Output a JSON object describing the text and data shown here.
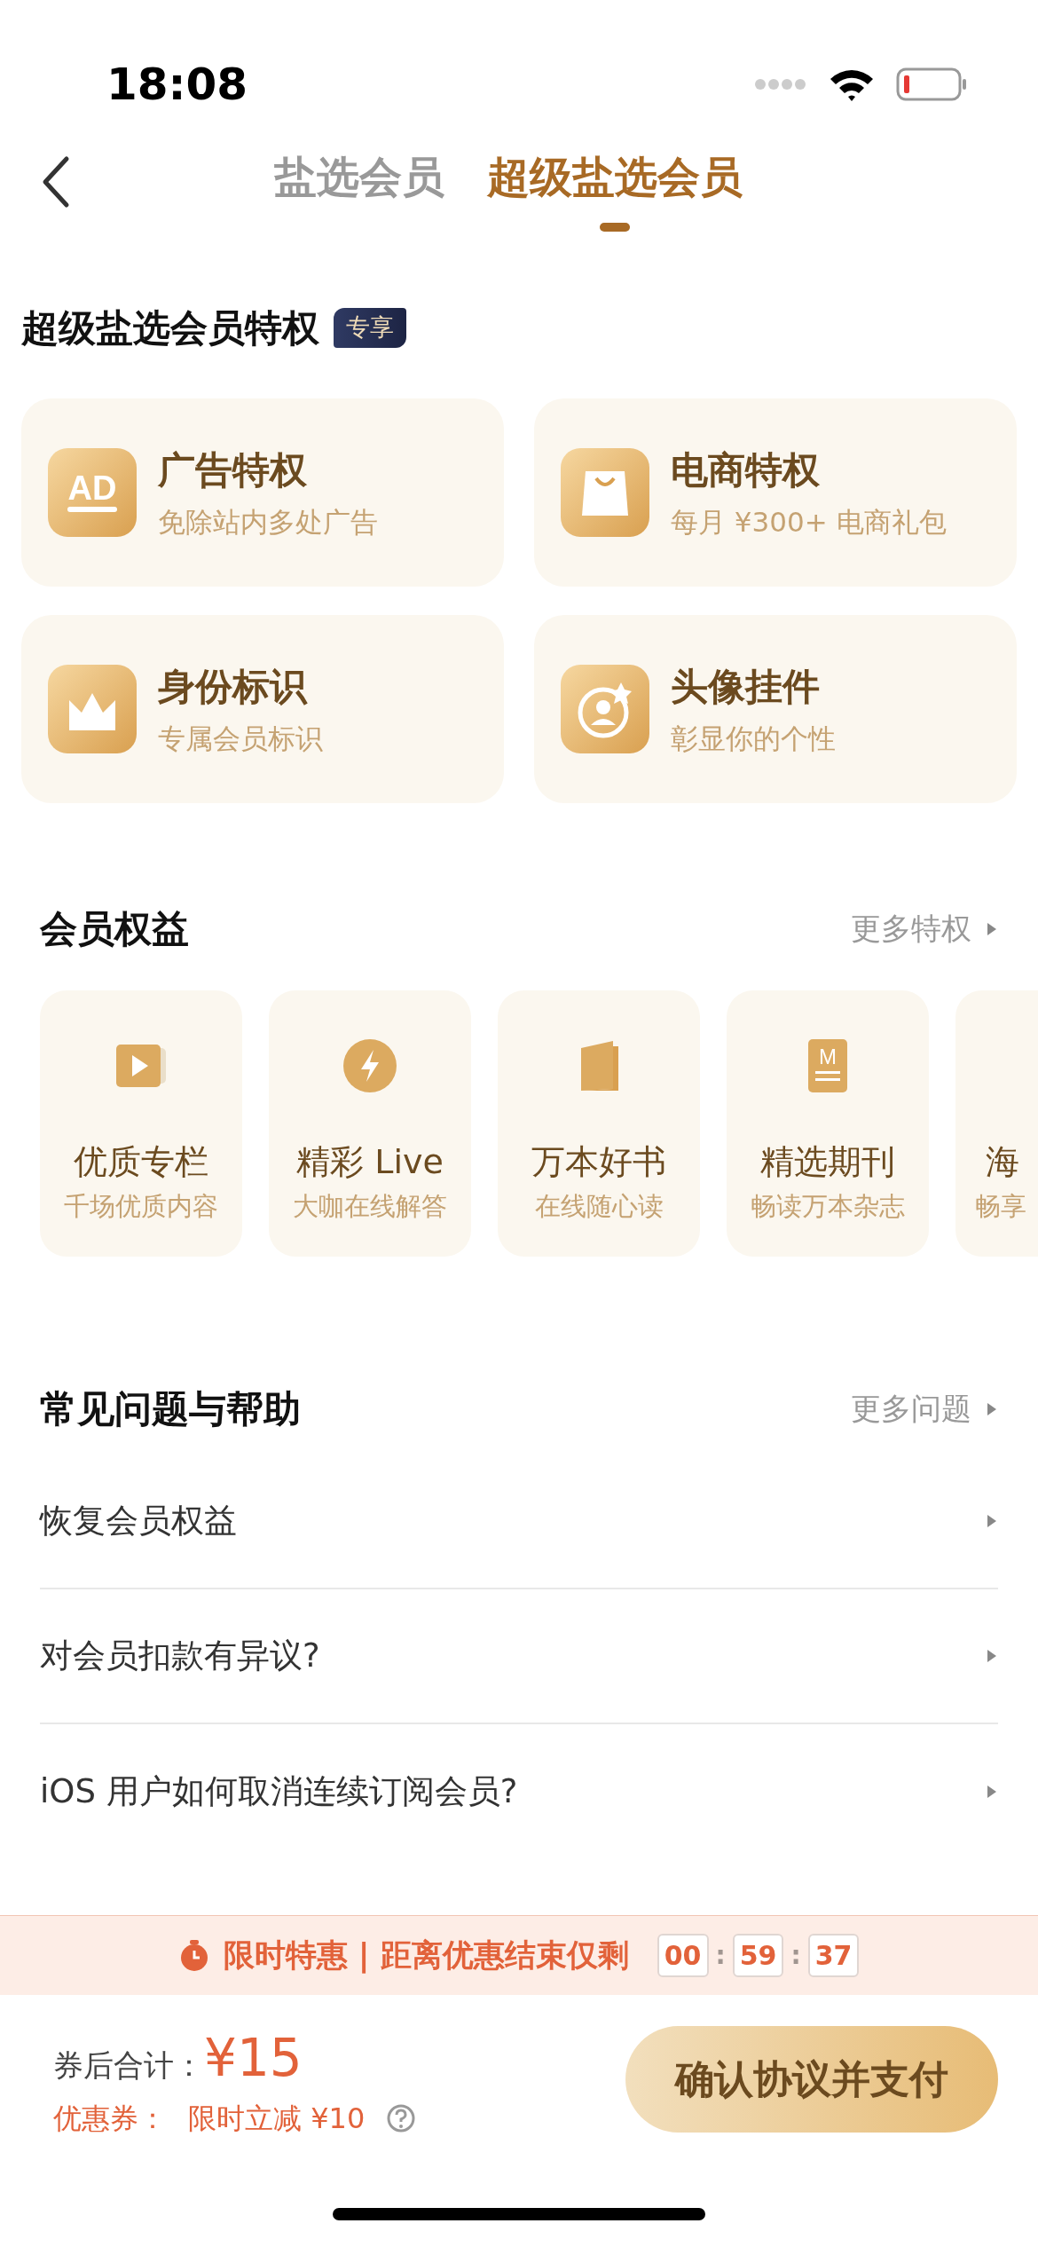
{
  "status_bar": {
    "time": "18:08"
  },
  "header": {
    "tabs": [
      {
        "label": "盐选会员",
        "selected": false
      },
      {
        "label": "超级盐选会员",
        "selected": true
      }
    ]
  },
  "privileges": {
    "title": "超级盐选会员特权",
    "badge": "专享",
    "items": [
      {
        "kind": "ad",
        "icon_text": "AD",
        "title": "广告特权",
        "subtitle": "免除站内多处广告"
      },
      {
        "kind": "bag",
        "title": "电商特权",
        "subtitle": "每月 ¥300+ 电商礼包"
      },
      {
        "kind": "crown",
        "title": "身份标识",
        "subtitle": "专属会员标识"
      },
      {
        "kind": "avatar",
        "title": "头像挂件",
        "subtitle": "彰显你的个性"
      }
    ]
  },
  "benefits": {
    "title": "会员权益",
    "more": "更多特权",
    "items": [
      {
        "kind": "video",
        "title": "优质专栏",
        "subtitle": "千场优质内容"
      },
      {
        "kind": "bolt",
        "title": "精彩 Live",
        "subtitle": "大咖在线解答"
      },
      {
        "kind": "book",
        "title": "万本好书",
        "subtitle": "在线随心读"
      },
      {
        "kind": "magazine",
        "icon_text": "M",
        "title": "精选期刊",
        "subtitle": "畅读万本杂志"
      },
      {
        "kind": "partial",
        "title": "海",
        "subtitle": "畅享"
      }
    ]
  },
  "faq": {
    "title": "常见问题与帮助",
    "more": "更多问题",
    "items": [
      "恢复会员权益",
      "对会员扣款有异议?",
      "iOS 用户如何取消连续订阅会员?"
    ]
  },
  "promo": {
    "label": "限时特惠 | 距离优惠结束仅剩",
    "countdown": [
      "00",
      "59",
      "37"
    ],
    "separator": ":"
  },
  "checkout": {
    "total_label": "券后合计：",
    "total": "¥15",
    "coupon_label": "优惠券：",
    "coupon": "限时立减 ¥10",
    "button": "确认协议并支付"
  }
}
